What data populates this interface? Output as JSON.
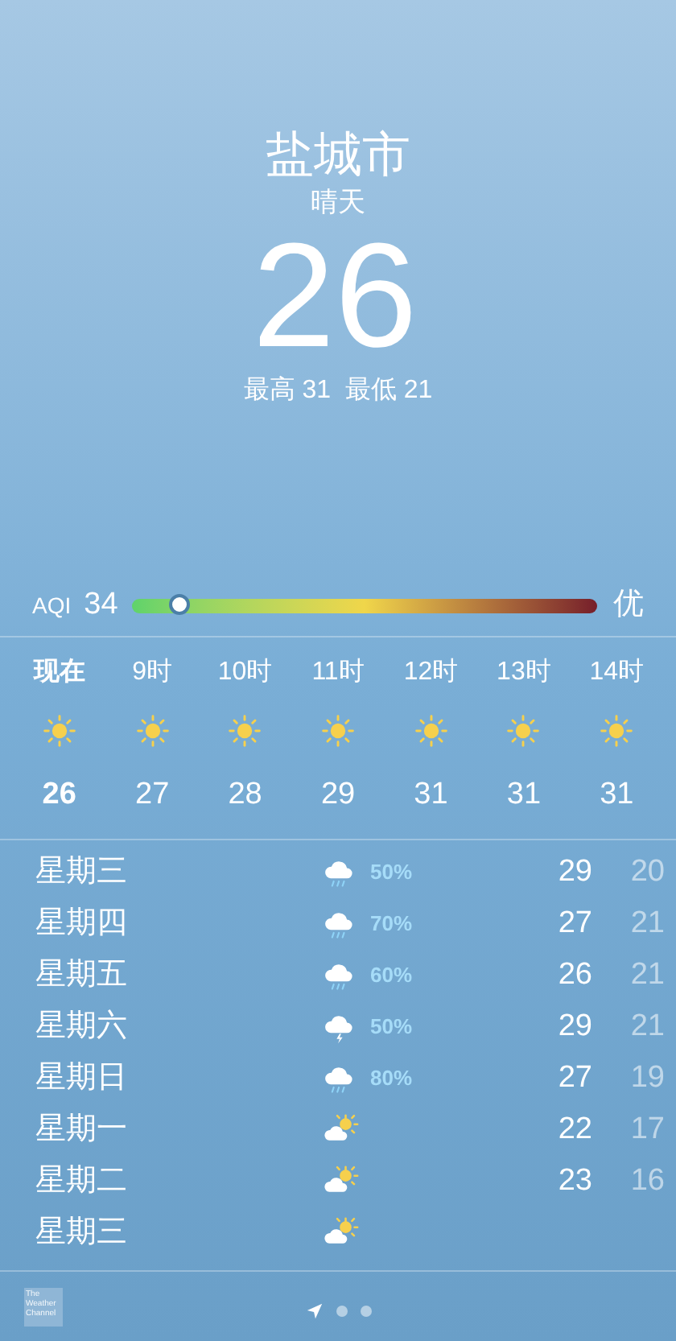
{
  "header": {
    "city": "盐城市",
    "condition": "晴天",
    "temperature": "26",
    "high_low": "最高 31  最低 21"
  },
  "aqi": {
    "label": "AQI",
    "value": "34",
    "level": 0.1,
    "rating": "优"
  },
  "hourly": [
    {
      "time": "现在",
      "kind": "sunny",
      "temp": "26",
      "selected": true
    },
    {
      "time": "9时",
      "kind": "sunny",
      "temp": "27",
      "selected": false
    },
    {
      "time": "10时",
      "kind": "sunny",
      "temp": "28",
      "selected": false
    },
    {
      "time": "11时",
      "kind": "sunny",
      "temp": "29",
      "selected": false
    },
    {
      "time": "12时",
      "kind": "sunny",
      "temp": "31",
      "selected": false
    },
    {
      "time": "13时",
      "kind": "sunny",
      "temp": "31",
      "selected": false
    },
    {
      "time": "14时",
      "kind": "sunny",
      "temp": "31",
      "selected": false
    }
  ],
  "daily": [
    {
      "day": "星期三",
      "kind": "rain",
      "chance": "50%",
      "high": "29",
      "low": "20"
    },
    {
      "day": "星期四",
      "kind": "rain",
      "chance": "70%",
      "high": "27",
      "low": "21"
    },
    {
      "day": "星期五",
      "kind": "rain",
      "chance": "60%",
      "high": "26",
      "low": "21"
    },
    {
      "day": "星期六",
      "kind": "thunder",
      "chance": "50%",
      "high": "29",
      "low": "21"
    },
    {
      "day": "星期日",
      "kind": "rain",
      "chance": "80%",
      "high": "27",
      "low": "19"
    },
    {
      "day": "星期一",
      "kind": "partly_cloudy",
      "high": "22",
      "low": "17"
    },
    {
      "day": "星期二",
      "kind": "partly_cloudy",
      "high": "23",
      "low": "16"
    },
    {
      "day": "星期三",
      "kind": "partly_cloudy"
    }
  ],
  "footer": {
    "logo_text": "The Weather Channel",
    "pages": [
      {
        "kind": "location",
        "selected": true
      },
      {
        "kind": "dot",
        "selected": false
      },
      {
        "kind": "dot",
        "selected": false
      }
    ]
  }
}
